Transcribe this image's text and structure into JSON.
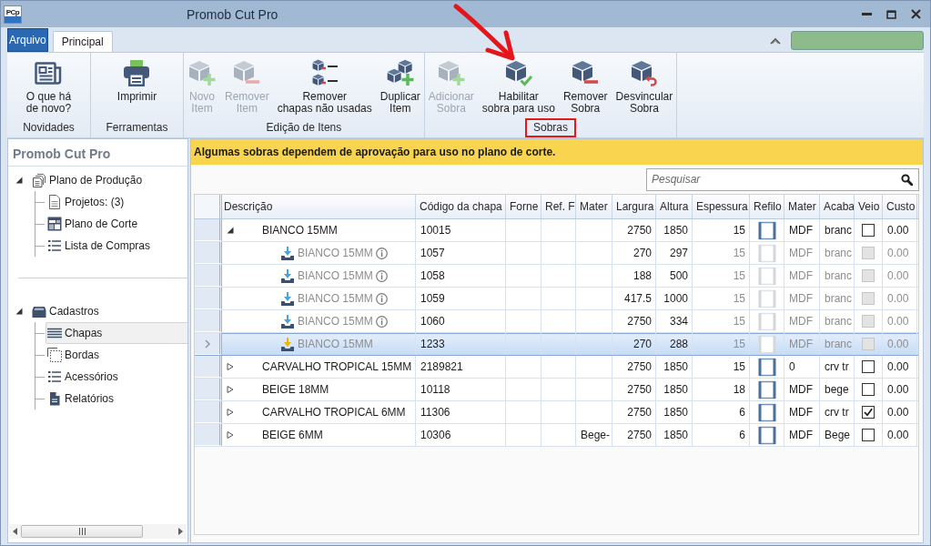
{
  "window": {
    "logo": "PCp",
    "title": "Promob Cut Pro"
  },
  "ribbon": {
    "tabs": [
      {
        "label": "Arquivo",
        "kind": "backstage",
        "selected": false
      },
      {
        "label": "Principal",
        "kind": "page",
        "selected": true
      }
    ],
    "groups": [
      {
        "label": "Novidades",
        "highlighted": false,
        "buttons": [
          {
            "label": "O que há\nde novo?",
            "kind": "news",
            "disabled": false,
            "marked": false
          }
        ]
      },
      {
        "label": "Ferramentas",
        "highlighted": false,
        "buttons": [
          {
            "label": "Imprimir",
            "kind": "print",
            "disabled": false,
            "marked": false
          }
        ]
      },
      {
        "label": "Edição de Itens",
        "highlighted": false,
        "buttons": [
          {
            "label": "Novo\nItem",
            "kind": "add",
            "disabled": true,
            "marked": false
          },
          {
            "label": "Remover\nItem",
            "kind": "remove",
            "disabled": true,
            "marked": false
          },
          {
            "label": "Remover\nchapas não usadas",
            "kind": "purge",
            "disabled": false,
            "marked": false
          },
          {
            "label": "Duplicar\nItem",
            "kind": "duplicate",
            "disabled": false,
            "marked": false
          }
        ]
      },
      {
        "label": "Sobras",
        "highlighted": true,
        "buttons": [
          {
            "label": "Adicionar\nSobra",
            "kind": "add",
            "disabled": true,
            "marked": false
          },
          {
            "label": "Habilitar\nsobra para uso",
            "kind": "enable",
            "disabled": false,
            "marked": true
          },
          {
            "label": "Remover\nSobra",
            "kind": "remove",
            "disabled": false,
            "marked": false
          },
          {
            "label": "Desvincular\nSobra",
            "kind": "unlink",
            "disabled": false,
            "marked": false
          }
        ]
      }
    ]
  },
  "sidebar": {
    "title": "Promob Cut Pro",
    "tree": [
      {
        "label": "Plano de Produção",
        "kind": "stack",
        "expanded": true,
        "selected": false,
        "children": [
          {
            "label": "Projetos: (3)",
            "kind": "document",
            "selected": false
          },
          {
            "label": "Plano de Corte",
            "kind": "layout",
            "selected": false
          },
          {
            "label": "Lista de Compras",
            "kind": "list",
            "selected": false
          }
        ]
      },
      {
        "label": "Cadastros",
        "kind": "tray",
        "expanded": true,
        "selected": false,
        "children": [
          {
            "label": "Chapas",
            "kind": "lines",
            "selected": true
          },
          {
            "label": "Bordas",
            "kind": "dashed",
            "selected": false
          },
          {
            "label": "Acessórios",
            "kind": "list",
            "selected": false
          },
          {
            "label": "Relatórios",
            "kind": "report",
            "selected": false
          }
        ]
      }
    ]
  },
  "banner": {
    "text": "Algumas sobras dependem de aprovação para uso no plano de corte."
  },
  "search": {
    "placeholder": "Pesquisar"
  },
  "table": {
    "columns": [
      {
        "label": "Descrição"
      },
      {
        "label": "Código da chapa"
      },
      {
        "label": "Forne"
      },
      {
        "label": "Ref. F"
      },
      {
        "label": "Mater"
      },
      {
        "label": "Largura"
      },
      {
        "label": "Altura"
      },
      {
        "label": "Espessura"
      },
      {
        "label": "Refilo"
      },
      {
        "label": "Mater"
      },
      {
        "label": "Acaba"
      },
      {
        "label": "Veio"
      },
      {
        "label": "Custo"
      }
    ],
    "rows": [
      {
        "kind": "sheet",
        "expanded": true,
        "selected": false,
        "disabled": false,
        "descricao": "BIANCO 15MM",
        "codigo": "10015",
        "largura": "2750",
        "altura": "1850",
        "espessura": "15",
        "column_11": "MDF",
        "column_12": "branc",
        "veio": false,
        "custo": "0.00",
        "children": [
          {
            "kind": "leftover",
            "color": "#4aa3df",
            "info": true,
            "selected": false,
            "disabled": true,
            "descricao": "BIANCO 15MM",
            "codigo": "1057",
            "largura": "270",
            "altura": "297",
            "espessura": "15",
            "column_11": "MDF",
            "column_12": "branc",
            "veio": false,
            "custo": "0.00"
          },
          {
            "kind": "leftover",
            "color": "#4aa3df",
            "info": true,
            "selected": false,
            "disabled": true,
            "descricao": "BIANCO 15MM",
            "codigo": "1058",
            "largura": "188",
            "altura": "500",
            "espessura": "15",
            "column_11": "MDF",
            "column_12": "branc",
            "veio": false,
            "custo": "0.00"
          },
          {
            "kind": "leftover",
            "color": "#4aa3df",
            "info": true,
            "selected": false,
            "disabled": true,
            "descricao": "BIANCO 15MM",
            "codigo": "1059",
            "largura": "417.5",
            "altura": "1000",
            "espessura": "15",
            "column_11": "MDF",
            "column_12": "branc",
            "veio": false,
            "custo": "0.00"
          },
          {
            "kind": "leftover",
            "color": "#4aa3df",
            "info": true,
            "selected": false,
            "disabled": true,
            "descricao": "BIANCO 15MM",
            "codigo": "1060",
            "largura": "2750",
            "altura": "334",
            "espessura": "15",
            "column_11": "MDF",
            "column_12": "branc",
            "veio": false,
            "custo": "0.00"
          },
          {
            "kind": "leftover",
            "color": "#f0b400",
            "info": false,
            "selected": true,
            "disabled": true,
            "descricao": "BIANCO 15MM",
            "codigo": "1233",
            "largura": "270",
            "altura": "288",
            "espessura": "15",
            "column_11": "MDF",
            "column_12": "branc",
            "veio": false,
            "custo": "0.00"
          }
        ]
      },
      {
        "kind": "sheet",
        "expanded": false,
        "selected": false,
        "disabled": false,
        "descricao": "CARVALHO TROPICAL 15MM",
        "codigo": "2189821",
        "largura": "2750",
        "altura": "1850",
        "espessura": "15",
        "column_11": "0",
        "column_12": "crv tr",
        "veio": false,
        "custo": "0.00"
      },
      {
        "kind": "sheet",
        "expanded": false,
        "selected": false,
        "disabled": false,
        "descricao": "BEIGE  18MM",
        "codigo": "10118",
        "largura": "2750",
        "altura": "1850",
        "espessura": "18",
        "column_11": "MDF",
        "column_12": "bege",
        "veio": false,
        "custo": "0.00"
      },
      {
        "kind": "sheet",
        "expanded": false,
        "selected": false,
        "disabled": false,
        "descricao": "CARVALHO TROPICAL 6MM",
        "codigo": "11306",
        "largura": "2750",
        "altura": "1850",
        "espessura": "6",
        "column_11": "MDF",
        "column_12": "crv tr",
        "veio": true,
        "custo": "0.00"
      },
      {
        "kind": "sheet",
        "expanded": false,
        "selected": false,
        "disabled": false,
        "descricao": "BEIGE 6MM",
        "codigo": "10306",
        "column_5": "Bege-",
        "largura": "2750",
        "altura": "1850",
        "espessura": "6",
        "column_11": "MDF",
        "column_12": "Bege",
        "veio": false,
        "custo": "0.00"
      }
    ]
  }
}
